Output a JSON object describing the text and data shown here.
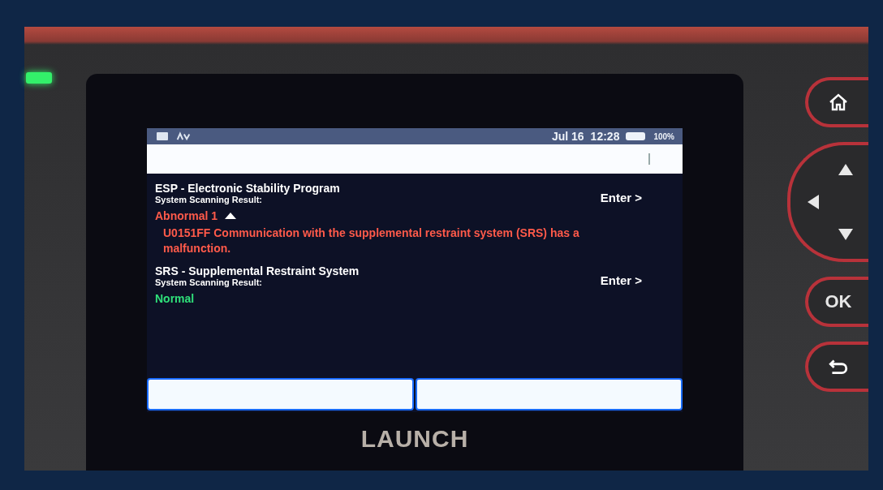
{
  "status_bar": {
    "date": "Jul 16",
    "time": "12:28",
    "battery": "100%"
  },
  "systems": [
    {
      "name": "ESP - Electronic Stability Program",
      "result_label": "System Scanning Result:",
      "action": "Enter >",
      "status": "Abnormal 1",
      "kind": "abnormal",
      "expanded": true,
      "faults": [
        "U0151FF Communication with the supplemental restraint system (SRS) has a malfunction."
      ]
    },
    {
      "name": "SRS - Supplemental Restraint System",
      "result_label": "System Scanning Result:",
      "action": "Enter >",
      "status": "Normal",
      "kind": "normal",
      "expanded": false
    }
  ],
  "device": {
    "brand": "LAUNCH",
    "keys": [
      {
        "kind": "home"
      },
      {
        "kind": "dpad"
      },
      {
        "kind": "ok",
        "label": "OK"
      },
      {
        "kind": "back"
      }
    ]
  }
}
